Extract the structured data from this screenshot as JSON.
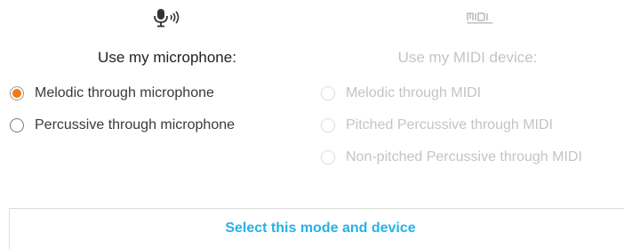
{
  "microphone": {
    "icon": "microphone-icon",
    "title": "Use my microphone:",
    "options": [
      {
        "label": "Melodic through microphone",
        "checked": true
      },
      {
        "label": "Percussive through microphone",
        "checked": false
      }
    ]
  },
  "midi": {
    "icon": "midi-icon",
    "title": "Use my MIDI device:",
    "disabled": true,
    "options": [
      {
        "label": "Melodic through MIDI",
        "checked": false
      },
      {
        "label": "Pitched Percussive through MIDI",
        "checked": false
      },
      {
        "label": "Non-pitched Percussive through MIDI",
        "checked": false
      }
    ]
  },
  "action": {
    "select_label": "Select this mode and device"
  },
  "colors": {
    "accent_radio": "#ef7a11",
    "link_blue": "#27b1e5",
    "disabled_gray": "#c4c4c4"
  }
}
